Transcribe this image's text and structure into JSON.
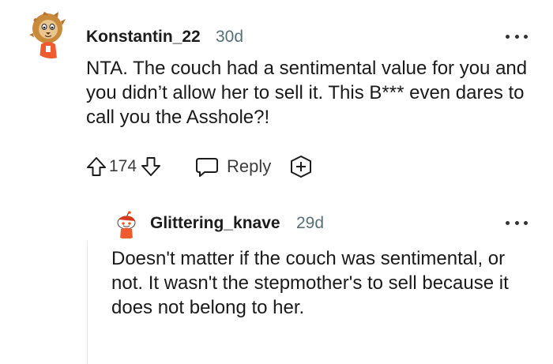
{
  "comments": [
    {
      "username": "Konstantin_22",
      "age": "30d",
      "body": "NTA. The couch had a sentimental value for you and you didn’t allow her to sell it. This B*** even dares to call you the Asshole?!",
      "votes": "174",
      "reply_label": "Reply"
    },
    {
      "username": "Glittering_knave",
      "age": "29d",
      "body": "Doesn't matter if the couch was sentimental, or not. It wasn't the stepmother's to sell because it does not belong to her."
    }
  ],
  "icons": {
    "upvote": "arrow-up-icon",
    "downvote": "arrow-down-icon",
    "reply": "speech-bubble-icon",
    "award": "plus-award-icon",
    "more": "ellipsis-icon"
  }
}
